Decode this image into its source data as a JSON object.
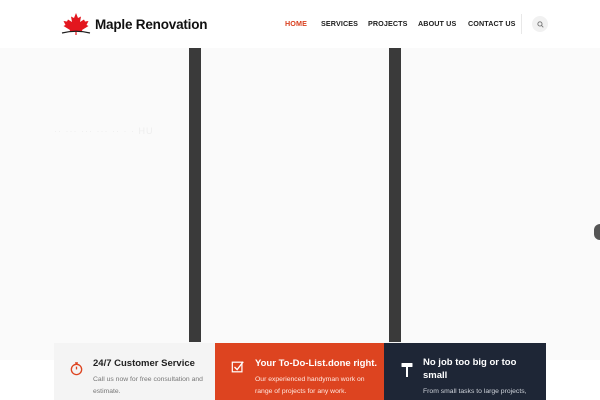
{
  "brand": {
    "name": "Maple Renovation",
    "logo_icon": "maple-leaf-icon",
    "logo_color": "#e3161e"
  },
  "nav": {
    "items": [
      {
        "label": "HOME",
        "active": true
      },
      {
        "label": "SERVICES",
        "active": false
      },
      {
        "label": "PROJECTS",
        "active": false
      },
      {
        "label": "ABOUT US",
        "active": false
      },
      {
        "label": "CONTACT US",
        "active": false
      }
    ],
    "search_icon": "search-icon",
    "accent_color": "#d9401f"
  },
  "hero": {
    "ghost_text": "·· ··· ··· ··· ·· · · HU"
  },
  "features": [
    {
      "icon": "stopwatch-icon",
      "title": "24/7 Customer Service",
      "text": "Call us now for free consultation and estimate.",
      "bg_color": "#f4f4f4"
    },
    {
      "icon": "checkbox-icon",
      "title": "Your To-Do-List.done right.",
      "text": "Our experienced handyman work on range of projects for any work.",
      "bg_color": "#dd4420"
    },
    {
      "icon": "hammer-icon",
      "title": "No job too big or too small",
      "text": "From small tasks to large projects,",
      "bg_color": "#1e2636"
    }
  ]
}
